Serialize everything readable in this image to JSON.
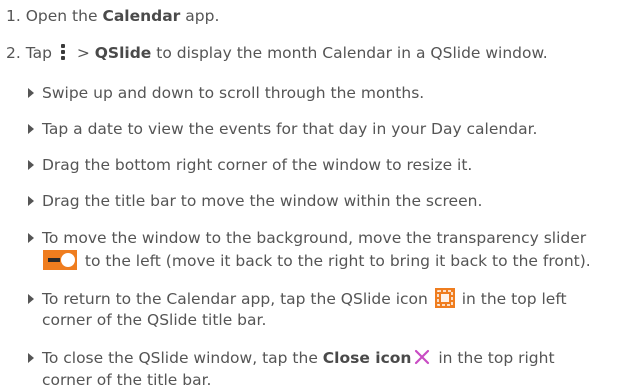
{
  "steps": [
    {
      "number": "1.",
      "text_before": "Open the ",
      "bold": "Calendar",
      "text_after": " app."
    },
    {
      "number": "2.",
      "text_tap": "Tap ",
      "separator": " > ",
      "bold": "QSlide",
      "text_after": " to display the month Calendar in a QSlide window.",
      "menu_icon": "menu-dots-icon"
    }
  ],
  "bullets": [
    {
      "text": "Swipe up and down to scroll through the months."
    },
    {
      "text": "Tap a date to view the events for that day in your Day calendar."
    },
    {
      "text": "Drag the bottom right corner of the window to resize it."
    },
    {
      "text": "Drag the title bar to move the window within the screen."
    },
    {
      "line1": "To move the window to the background, move the transparency slider",
      "line2_after": " to the left (move it back to the right to bring it back to the front).",
      "icon": "transparency-slider-icon"
    },
    {
      "line1_before": "To return to the Calendar app, tap the QSlide icon ",
      "line1_after": " in the top left",
      "line2": "corner of the QSlide title bar.",
      "icon": "qslide-icon"
    },
    {
      "line1_before": "To close the QSlide window, tap the ",
      "bold": "Close icon",
      "line1_after": " in the top right",
      "line2": "corner of the title bar.",
      "icon": "close-icon"
    }
  ],
  "colors": {
    "text": "#555555",
    "accent_orange": "#ef7d1f",
    "close_icon": "#c94cc4"
  }
}
